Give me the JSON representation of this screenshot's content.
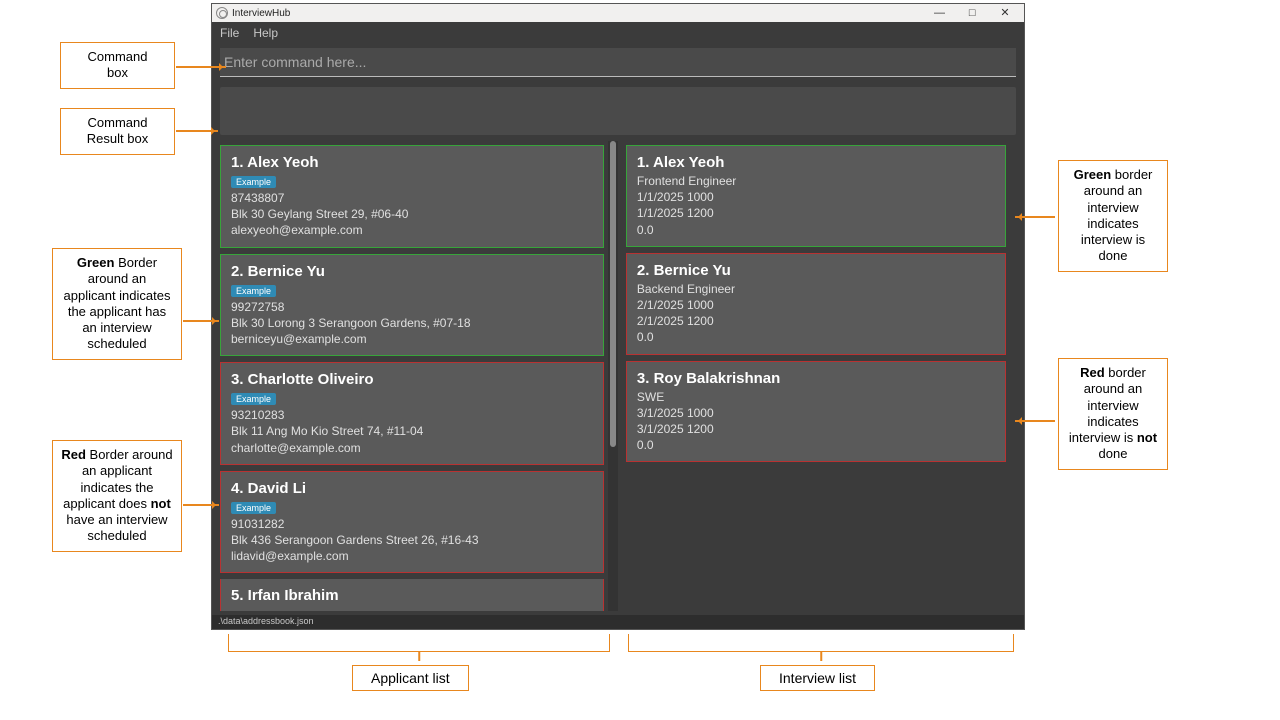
{
  "window": {
    "title": "InterviewHub",
    "min": "—",
    "max": "□",
    "close": "✕"
  },
  "menu": {
    "file": "File",
    "help": "Help"
  },
  "command": {
    "placeholder": "Enter command here..."
  },
  "statusbar": ".\\data\\addressbook.json",
  "applicants": [
    {
      "idx": "1.",
      "name": "Alex Yeoh",
      "badge": "Example",
      "phone": "87438807",
      "addr": "Blk 30 Geylang Street 29, #06-40",
      "email": "alexyeoh@example.com",
      "border": "green"
    },
    {
      "idx": "2.",
      "name": "Bernice Yu",
      "badge": "Example",
      "phone": "99272758",
      "addr": "Blk 30 Lorong 3 Serangoon Gardens, #07-18",
      "email": "berniceyu@example.com",
      "border": "green"
    },
    {
      "idx": "3.",
      "name": "Charlotte Oliveiro",
      "badge": "Example",
      "phone": "93210283",
      "addr": "Blk 11 Ang Mo Kio Street 74, #11-04",
      "email": "charlotte@example.com",
      "border": "red"
    },
    {
      "idx": "4.",
      "name": "David Li",
      "badge": "Example",
      "phone": "91031282",
      "addr": "Blk 436 Serangoon Gardens Street 26, #16-43",
      "email": "lidavid@example.com",
      "border": "red"
    },
    {
      "idx": "5.",
      "name": "Irfan Ibrahim",
      "border": "red",
      "partial": true
    }
  ],
  "interviews": [
    {
      "idx": "1.",
      "name": "Alex Yeoh",
      "role": "Frontend Engineer",
      "t1": "1/1/2025 1000",
      "t2": "1/1/2025 1200",
      "score": "0.0",
      "border": "green"
    },
    {
      "idx": "2.",
      "name": "Bernice Yu",
      "role": "Backend Engineer",
      "t1": "2/1/2025 1000",
      "t2": "2/1/2025 1200",
      "score": "0.0",
      "border": "red"
    },
    {
      "idx": "3.",
      "name": "Roy Balakrishnan",
      "role": "SWE",
      "t1": "3/1/2025 1000",
      "t2": "3/1/2025 1200",
      "score": "0.0",
      "border": "red"
    }
  ],
  "callouts": {
    "cmd": "Command\nbox",
    "result": "Command\nResult box",
    "green_applicant": "Green Border around an applicant indicates the applicant has an interview scheduled",
    "red_applicant": "Red Border around an applicant indicates the applicant does not have an interview scheduled",
    "green_interview": "Green border around an interview indicates interview is done",
    "red_interview": "Red border around an interview indicates interview is not done",
    "applicant_list": "Applicant list",
    "interview_list": "Interview list"
  }
}
